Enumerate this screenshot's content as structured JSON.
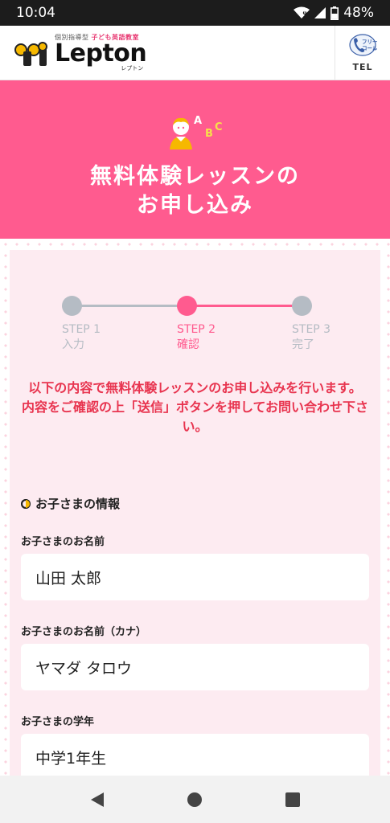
{
  "status_bar": {
    "time": "10:04",
    "battery": "48%",
    "icons": [
      "wifi-icon",
      "signal-icon",
      "battery-icon"
    ]
  },
  "header": {
    "logo": {
      "tagline_1": "個別指導型",
      "tagline_2": "子ども英語教室",
      "wordmark": "Lepton",
      "kana": "レプトン"
    },
    "tel": {
      "badge_top": "フリー",
      "badge_bottom": "コール",
      "label": "TEL"
    }
  },
  "hero": {
    "icon": "child-abc-icon",
    "title_line1": "無料体験レッスンの",
    "title_line2": "お申し込み"
  },
  "stepper": {
    "steps": [
      {
        "label": "STEP 1",
        "sub": "入力",
        "state": "done"
      },
      {
        "label": "STEP 2",
        "sub": "確認",
        "state": "active"
      },
      {
        "label": "STEP 3",
        "sub": "完了",
        "state": "pending"
      }
    ]
  },
  "notice": {
    "line1": "以下の内容で無料体験レッスンのお申し込みを行います。",
    "line2": "内容をご確認の上「送信」ボタンを押してお問い合わせ下さい。"
  },
  "child_info": {
    "section_title": "お子さまの情報",
    "fields": [
      {
        "label": "お子さまのお名前",
        "value": "山田 太郎"
      },
      {
        "label": "お子さまのお名前（カナ）",
        "value": "ヤマダ タロウ"
      },
      {
        "label": "お子さまの学年",
        "value": "中学1年生"
      }
    ]
  },
  "colors": {
    "brand_pink": "#ff5b8f",
    "card_bg": "#fdebf1",
    "notice_red": "#e8344f",
    "step_gray": "#b5bcc4"
  },
  "nav": {
    "icons": [
      "back-icon",
      "home-icon",
      "recents-icon"
    ]
  }
}
